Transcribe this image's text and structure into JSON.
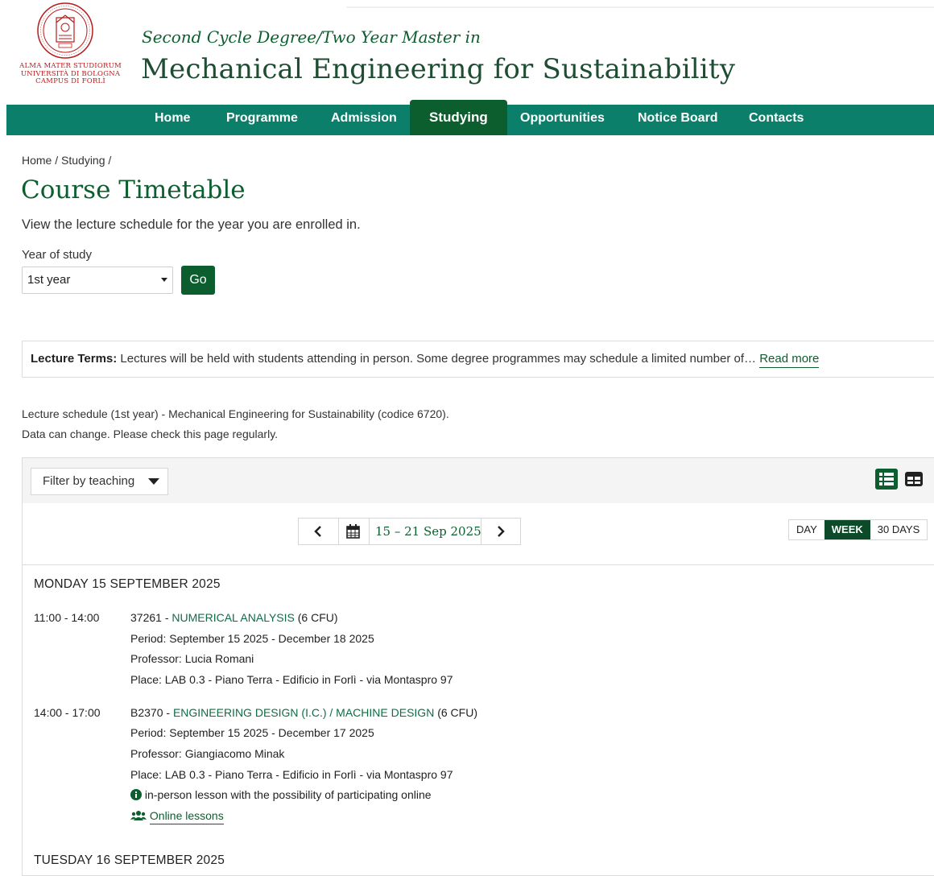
{
  "header": {
    "logo_text": [
      "ALMA MATER STUDIORUM",
      "UNIVERSITÀ DI BOLOGNA",
      "CAMPUS DI FORLÌ"
    ],
    "subtitle": "Second Cycle Degree/Two Year Master in",
    "title": "Mechanical Engineering for Sustainability"
  },
  "nav": {
    "items": [
      "Home",
      "Programme",
      "Admission",
      "Studying",
      "Opportunities",
      "Notice Board",
      "Contacts"
    ],
    "active": "Studying"
  },
  "breadcrumb": "Home / Studying /",
  "page": {
    "title": "Course Timetable",
    "intro": "View the lecture schedule for the year you are enrolled in."
  },
  "year_select": {
    "label": "Year of study",
    "value": "1st year",
    "go_label": "Go"
  },
  "terms": {
    "label": "Lecture Terms:",
    "text": " Lectures  will be held with students attending in person. Some degree programmes may schedule a limited number of… ",
    "read_more": "Read more"
  },
  "schedule_note": [
    "Lecture schedule (1st year) - Mechanical Engineering for Sustainability (codice 6720).",
    "Data can change. Please check this page regularly."
  ],
  "toolbar": {
    "filter_label": "Filter by teaching",
    "date_range": "15 – 21 Sep 2025",
    "range_options": [
      "DAY",
      "WEEK",
      "30 DAYS"
    ],
    "range_active": "WEEK"
  },
  "colors": {
    "brand_green": "#0d5e2f",
    "nav_teal": "#0c7f6b",
    "seal_red": "#b71c1c"
  },
  "days": [
    {
      "header": "MONDAY 15 SEPTEMBER 2025",
      "events": [
        {
          "time": "11:00 - 14:00",
          "code": "37261 - ",
          "name": "NUMERICAL ANALYSIS",
          "cfu": " (6 CFU)",
          "period": "Period: September 15 2025 - December 18 2025",
          "professor": "Professor: Lucia Romani",
          "place": "Place: LAB 0.3 - Piano Terra - Edificio in Forlì - via Montaspro 97"
        },
        {
          "time": "14:00 - 17:00",
          "code": "B2370 - ",
          "name": "ENGINEERING DESIGN (I.C.) / MACHINE DESIGN",
          "cfu": " (6 CFU)",
          "period": "Period: September 15 2025 - December 17 2025",
          "professor": "Professor: Giangiacomo Minak",
          "place": "Place: LAB 0.3 - Piano Terra - Edificio in Forlì - via Montaspro 97",
          "note": "in-person lesson with the possibility of participating online",
          "online": "Online lessons"
        }
      ]
    },
    {
      "header": "TUESDAY 16 SEPTEMBER 2025"
    }
  ]
}
